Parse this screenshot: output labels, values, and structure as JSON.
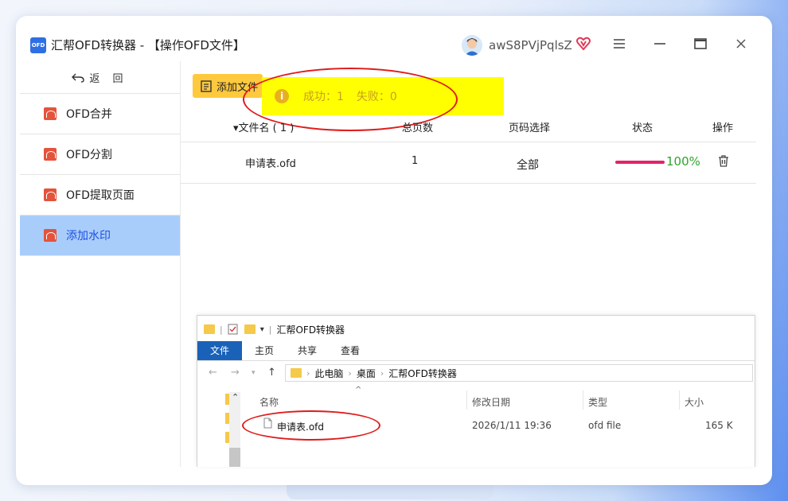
{
  "window": {
    "title": "汇帮OFD转换器 - 【操作OFD文件】",
    "logo_text": "OFD",
    "user_name": "awS8PVjPqlsZ",
    "minimize_icon": "minus-icon",
    "menu_icon": "hamburger-icon",
    "maximize_icon": "window-icon",
    "close_icon": "close-icon"
  },
  "sidebar": {
    "back_label": "返 回",
    "items": [
      {
        "label": "OFD合并",
        "active": false
      },
      {
        "label": "OFD分割",
        "active": false
      },
      {
        "label": "OFD提取页面",
        "active": false
      },
      {
        "label": "添加水印",
        "active": true
      }
    ]
  },
  "main": {
    "add_file_label": "添加文件",
    "toast": {
      "success_label": "成功：1",
      "fail_label": "失败：0"
    },
    "table": {
      "headers": [
        "▾文件名 ( 1 )",
        "总页数",
        "页码选择",
        "状态",
        "操作"
      ],
      "rows": [
        {
          "file_name": "申请表.ofd",
          "pages": "1",
          "page_select": "全部",
          "progress_text": "100%",
          "progress": 1.0
        }
      ]
    }
  },
  "explorer": {
    "title": "汇帮OFD转换器",
    "tabs": [
      "文件",
      "主页",
      "共享",
      "查看"
    ],
    "breadcrumb": [
      "此电脑",
      "桌面",
      "汇帮OFD转换器"
    ],
    "columns": [
      "名称",
      "修改日期",
      "类型",
      "大小"
    ],
    "files": [
      {
        "name": "申请表.ofd",
        "modified": "2026/1/11 19:36",
        "type": "ofd file",
        "size": "165 K"
      }
    ]
  },
  "colors": {
    "accent_blue": "#1e4fe0",
    "active_nav_bg": "#a9cdfb",
    "add_button": "#ffc93e",
    "toast_bg": "#ffff00",
    "progress": "#e1246a",
    "percent_text": "#2ea52e",
    "annotation_red": "#e01b1b"
  }
}
